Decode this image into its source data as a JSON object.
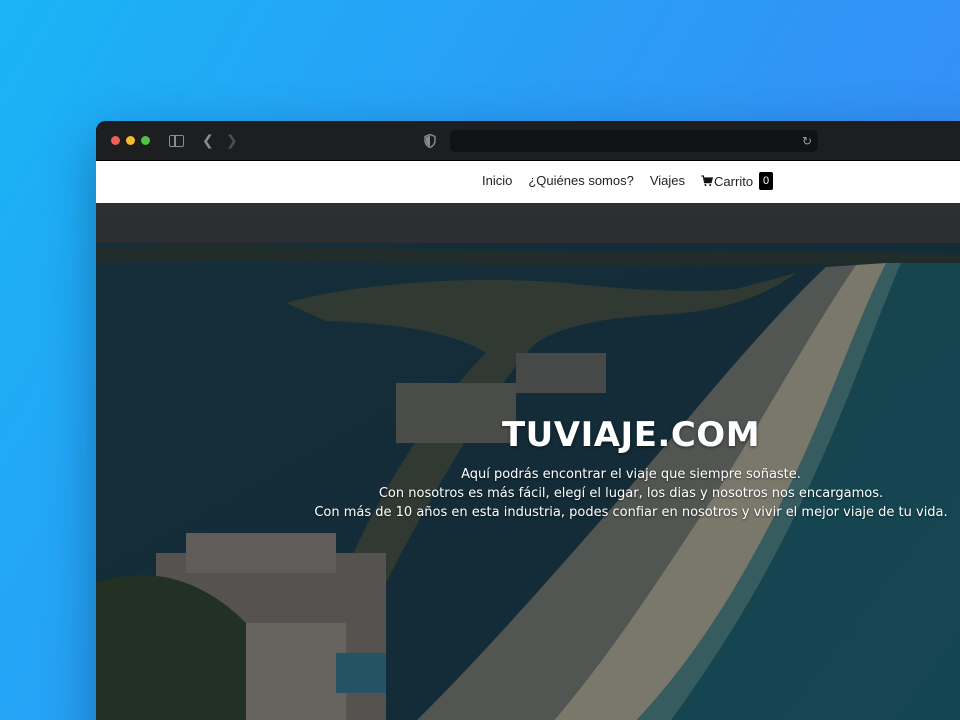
{
  "browser": {
    "address_bar": "",
    "icons": [
      "sidebar-icon",
      "back-arrow-icon",
      "forward-arrow-icon",
      "shield-icon",
      "reload-icon"
    ]
  },
  "navbar": {
    "links": [
      {
        "label": "Inicio"
      },
      {
        "label": "¿Quiénes somos?"
      },
      {
        "label": "Viajes"
      }
    ],
    "cart": {
      "label": "Carrito",
      "count": "0",
      "icon": "cart-icon"
    }
  },
  "hero": {
    "title": "TUVIAJE.COM",
    "lines": [
      "Aquí podrás encontrar el viaje que siempre soñaste.",
      "Con nosotros es más fácil, elegí el lugar, los dias y nosotros nos encargamos.",
      "Con más de 10 años en esta industria, podes confiar en nosotros y vivir el mejor viaje de tu vida."
    ]
  },
  "colors": {
    "background_gradient_start": "#1ab4f5",
    "background_gradient_end": "#3d86f5",
    "window_chrome": "#1d1e20",
    "navbar": "#ffffff",
    "cart_badge": "#000000"
  }
}
